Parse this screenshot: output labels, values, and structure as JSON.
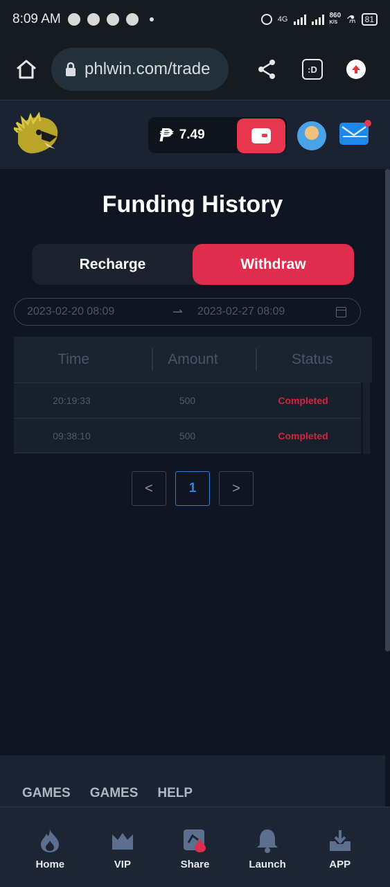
{
  "status_bar": {
    "time": "8:09 AM",
    "network": "4G",
    "speed": "860",
    "speed_unit": "K/S",
    "battery": "81"
  },
  "browser": {
    "url": "phlwin.com/trade",
    "tabs_label": ":D"
  },
  "header": {
    "currency_icon": "peso-icon",
    "balance": "7.49"
  },
  "page": {
    "title": "Funding History",
    "tabs": [
      {
        "label": "Recharge",
        "active": false
      },
      {
        "label": "Withdraw",
        "active": true
      }
    ],
    "date_range": {
      "start": "2023-02-20 08:09",
      "separator": "⇀",
      "end": "2023-02-27 08:09"
    },
    "table": {
      "columns": [
        "Time",
        "Amount",
        "Status"
      ],
      "rows": [
        {
          "time": "20:19:33",
          "amount": "500",
          "status": "Completed"
        },
        {
          "time": "09:38:10",
          "amount": "500",
          "status": "Completed"
        }
      ]
    },
    "pagination": {
      "prev": "<",
      "current": "1",
      "next": ">"
    }
  },
  "footer": {
    "links": [
      "GAMES",
      "GAMES",
      "HELP"
    ]
  },
  "bottom_nav": [
    {
      "label": "Home",
      "icon": "flame-icon"
    },
    {
      "label": "VIP",
      "icon": "crown-icon"
    },
    {
      "label": "Share",
      "icon": "share-card-icon"
    },
    {
      "label": "Launch",
      "icon": "bell-icon"
    },
    {
      "label": "APP",
      "icon": "download-tray-icon"
    }
  ],
  "colors": {
    "accent": "#e02d4d",
    "status_completed": "#d0263f",
    "page_number": "#2f86e0"
  }
}
